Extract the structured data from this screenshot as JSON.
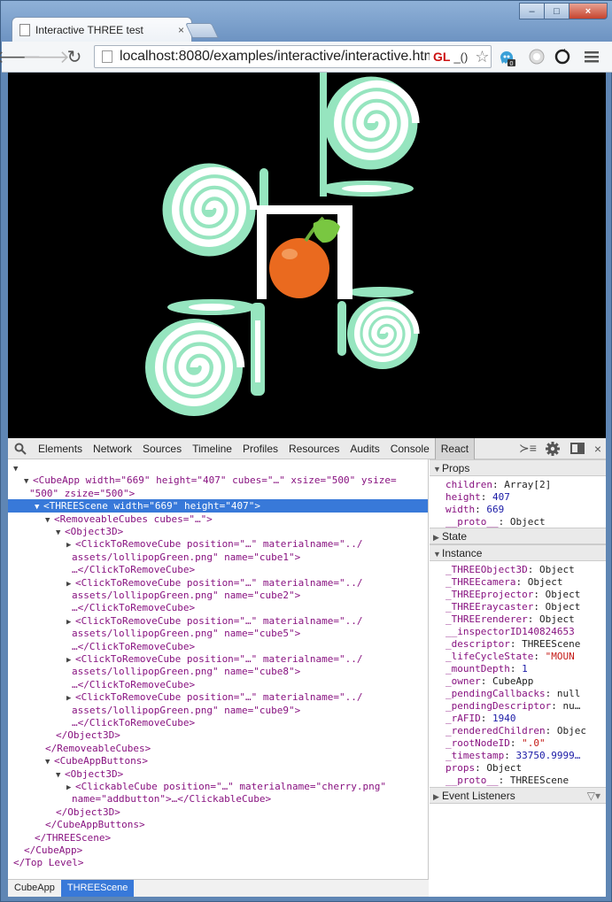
{
  "browser": {
    "tab_title": "Interactive THREE test",
    "tab_close": "×",
    "url": "localhost:8080/examples/interactive/interactive.htm",
    "gl_badge": "GL",
    "extra": "_()",
    "ext_badge": "0",
    "window_buttons": {
      "minimize": "‒",
      "maximize": "□",
      "close": "×"
    }
  },
  "devtools": {
    "tabs": [
      "Elements",
      "Network",
      "Sources",
      "Timeline",
      "Profiles",
      "Resources",
      "Audits",
      "Console",
      "React"
    ],
    "active_tab": "React",
    "tree": [
      {
        "indent": 0,
        "tri": "▼",
        "html": "<Top Level>"
      },
      {
        "indent": 1,
        "tri": "▼",
        "tag": "CubeApp",
        "attrs": [
          [
            "width",
            "669"
          ],
          [
            "height",
            "407"
          ],
          [
            "cubes",
            "…"
          ],
          [
            "xsize",
            "500"
          ],
          [
            "ysize",
            null
          ]
        ]
      },
      {
        "indent": 1,
        "cont": "\"500\" zsize=\"500\">"
      },
      {
        "indent": 2,
        "tri": "▼",
        "selected": true,
        "text": "<THREEScene width=\"669\" height=\"407\">"
      },
      {
        "indent": 3,
        "tri": "▼",
        "text": "<RemoveableCubes cubes=\"…\">"
      },
      {
        "indent": 4,
        "tri": "▼",
        "text": "<Object3D>"
      },
      {
        "indent": 5,
        "tri": "▶",
        "text": "<ClickToRemoveCube position=\"…\" materialname=\"../"
      },
      {
        "indent": 5,
        "cont": "assets/lollipopGreen.png\" name=\"cube1\">"
      },
      {
        "indent": 5,
        "cont": "…</ClickToRemoveCube>"
      },
      {
        "indent": 5,
        "tri": "▶",
        "text": "<ClickToRemoveCube position=\"…\" materialname=\"../"
      },
      {
        "indent": 5,
        "cont": "assets/lollipopGreen.png\" name=\"cube2\">"
      },
      {
        "indent": 5,
        "cont": "…</ClickToRemoveCube>"
      },
      {
        "indent": 5,
        "tri": "▶",
        "text": "<ClickToRemoveCube position=\"…\" materialname=\"../"
      },
      {
        "indent": 5,
        "cont": "assets/lollipopGreen.png\" name=\"cube5\">"
      },
      {
        "indent": 5,
        "cont": "…</ClickToRemoveCube>"
      },
      {
        "indent": 5,
        "tri": "▶",
        "text": "<ClickToRemoveCube position=\"…\" materialname=\"../"
      },
      {
        "indent": 5,
        "cont": "assets/lollipopGreen.png\" name=\"cube8\">"
      },
      {
        "indent": 5,
        "cont": "…</ClickToRemoveCube>"
      },
      {
        "indent": 5,
        "tri": "▶",
        "text": "<ClickToRemoveCube position=\"…\" materialname=\"../"
      },
      {
        "indent": 5,
        "cont": "assets/lollipopGreen.png\" name=\"cube9\">"
      },
      {
        "indent": 5,
        "cont": "…</ClickToRemoveCube>"
      },
      {
        "indent": 4,
        "text": "</Object3D>"
      },
      {
        "indent": 3,
        "text": "</RemoveableCubes>"
      },
      {
        "indent": 3,
        "tri": "▼",
        "text": "<CubeAppButtons>"
      },
      {
        "indent": 4,
        "tri": "▼",
        "text": "<Object3D>"
      },
      {
        "indent": 5,
        "tri": "▶",
        "text": "<ClickableCube position=\"…\" materialname=\"cherry.png\""
      },
      {
        "indent": 5,
        "cont": "name=\"addbutton\">…</ClickableCube>"
      },
      {
        "indent": 4,
        "text": "</Object3D>"
      },
      {
        "indent": 3,
        "text": "</CubeAppButtons>"
      },
      {
        "indent": 2,
        "text": "</THREEScene>"
      },
      {
        "indent": 1,
        "text": "</CubeApp>"
      },
      {
        "indent": 0,
        "text": "</Top Level>"
      }
    ],
    "breadcrumbs": [
      "CubeApp",
      "THREEScene"
    ],
    "sidebar": {
      "props_header": "Props",
      "props": [
        {
          "tri": "▶",
          "key": "children",
          "val": "Array[2]",
          "kind": "obj"
        },
        {
          "key": "height",
          "val": "407",
          "kind": "num"
        },
        {
          "key": "width",
          "val": "669",
          "kind": "num"
        },
        {
          "tri": "▶",
          "key": "__proto__",
          "val": "Object",
          "kind": "obj"
        }
      ],
      "state_header": "State",
      "instance_header": "Instance",
      "instance": [
        {
          "tri": "▶",
          "key": "_THREEObject3D",
          "val": "Object",
          "kind": "obj"
        },
        {
          "tri": "▶",
          "key": "_THREEcamera",
          "val": "Object",
          "kind": "obj"
        },
        {
          "tri": "▶",
          "key": "_THREEprojector",
          "val": "Object",
          "kind": "obj"
        },
        {
          "tri": "▶",
          "key": "_THREEraycaster",
          "val": "Object",
          "kind": "obj"
        },
        {
          "tri": "▶",
          "key": "_THREErenderer",
          "val": "Object",
          "kind": "obj"
        },
        {
          "key": "__inspectorID140824653",
          "val": "",
          "kind": "obj"
        },
        {
          "tri": "▶",
          "key": "_descriptor",
          "val": "THREEScene",
          "kind": "obj"
        },
        {
          "key": "_lifeCycleState",
          "val": "\"MOUN",
          "kind": "str"
        },
        {
          "key": "_mountDepth",
          "val": "1",
          "kind": "num"
        },
        {
          "tri": "▶",
          "key": "_owner",
          "val": "CubeApp",
          "kind": "obj"
        },
        {
          "key": "_pendingCallbacks",
          "val": "null",
          "kind": "obj"
        },
        {
          "key": "_pendingDescriptor",
          "val": "nu…",
          "kind": "obj"
        },
        {
          "key": "_rAFID",
          "val": "1940",
          "kind": "num"
        },
        {
          "tri": "▶",
          "key": "_renderedChildren",
          "val": "Objec",
          "kind": "obj"
        },
        {
          "key": "_rootNodeID",
          "val": "\".0\"",
          "kind": "str"
        },
        {
          "key": "_timestamp",
          "val": "33750.9999…",
          "kind": "num"
        },
        {
          "tri": "▶",
          "key": "props",
          "val": "Object",
          "kind": "obj"
        },
        {
          "tri": "▶",
          "key": "__proto__",
          "val": "THREEScene",
          "kind": "obj"
        }
      ],
      "events_header": "Event Listeners"
    }
  }
}
